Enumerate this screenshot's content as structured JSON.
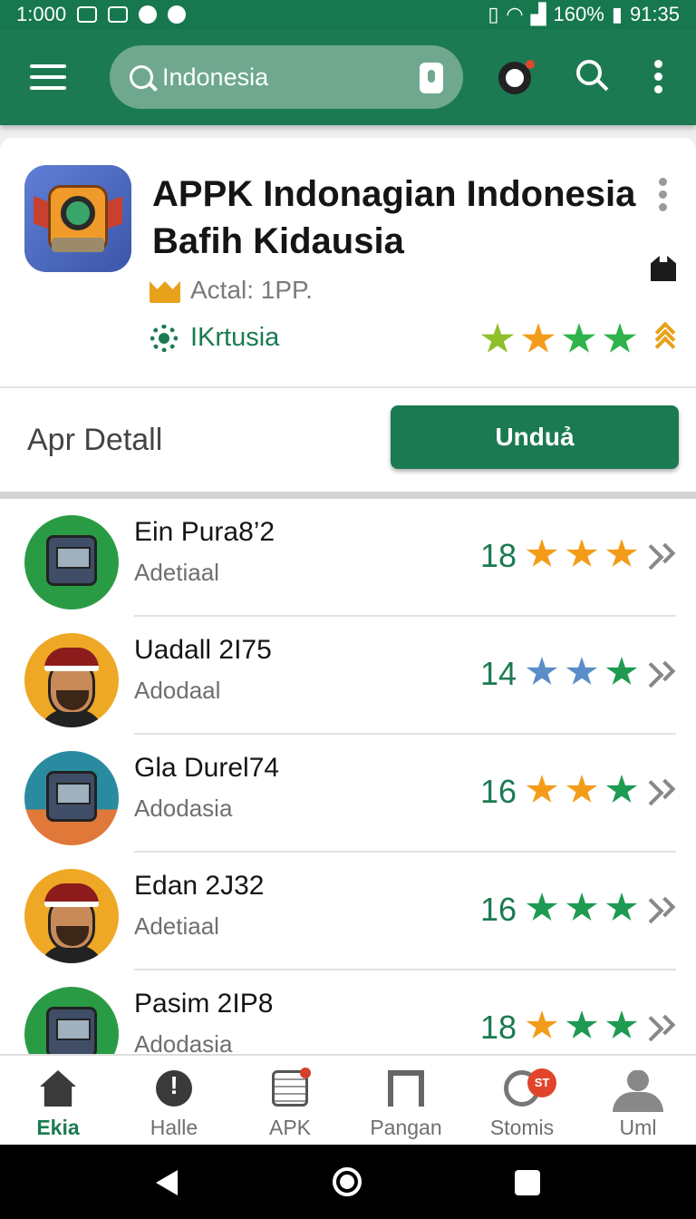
{
  "status_bar": {
    "time_left": "1:000",
    "battery": "160%",
    "clock": "91:35"
  },
  "search": {
    "text": "Indonesia"
  },
  "app": {
    "title_line1": "APPK Indonagian Indonesia",
    "title_line2": "Bafih Kidausia",
    "meta": "Actal: 1PP.",
    "developer": "IKrtusia",
    "star_colors": [
      "#8fbf2a",
      "#f39c1a",
      "#2fb34a",
      "#2fb34a"
    ]
  },
  "detail": {
    "label": "Apr Detall",
    "download_label": "Unduả"
  },
  "list": [
    {
      "name": "Ein Pura8’2",
      "sub": "Adetiaal",
      "count": "18",
      "avatar": "robot-green",
      "stars": [
        "#f39c1a",
        "#f39c1a",
        "#f39c1a"
      ]
    },
    {
      "name": "Uadall 2I75",
      "sub": "Adodaal",
      "count": "14",
      "avatar": "person-yellow",
      "stars": [
        "#5b8ec9",
        "#5b8ec9",
        "#1e9a52"
      ]
    },
    {
      "name": "Gla Durel74",
      "sub": "Adodasia",
      "count": "16",
      "avatar": "robot-teal",
      "stars": [
        "#f39c1a",
        "#f39c1a",
        "#1e9a52"
      ]
    },
    {
      "name": "Edan 2J32",
      "sub": "Adetiaal",
      "count": "16",
      "avatar": "person-yellow",
      "stars": [
        "#1e9a52",
        "#1e9a52",
        "#1e9a52"
      ]
    },
    {
      "name": "Pasim 2IP8",
      "sub": "Adodasia",
      "count": "18",
      "avatar": "robot-green",
      "stars": [
        "#f39c1a",
        "#1e9a52",
        "#1e9a52"
      ]
    }
  ],
  "bottom_nav": [
    {
      "label": "Ekia",
      "icon": "home-icon",
      "active": true
    },
    {
      "label": "Halle",
      "icon": "alert-icon"
    },
    {
      "label": "APK",
      "icon": "apk-icon"
    },
    {
      "label": "Pangan",
      "icon": "pangan-icon"
    },
    {
      "label": "Stomis",
      "icon": "stomis-icon",
      "badge": "ST"
    },
    {
      "label": "Uml",
      "icon": "user-icon"
    }
  ],
  "colors": {
    "brand": "#1b7a51",
    "star_orange": "#f39c1a",
    "star_green": "#1e9a52",
    "star_blue": "#5b8ec9"
  }
}
